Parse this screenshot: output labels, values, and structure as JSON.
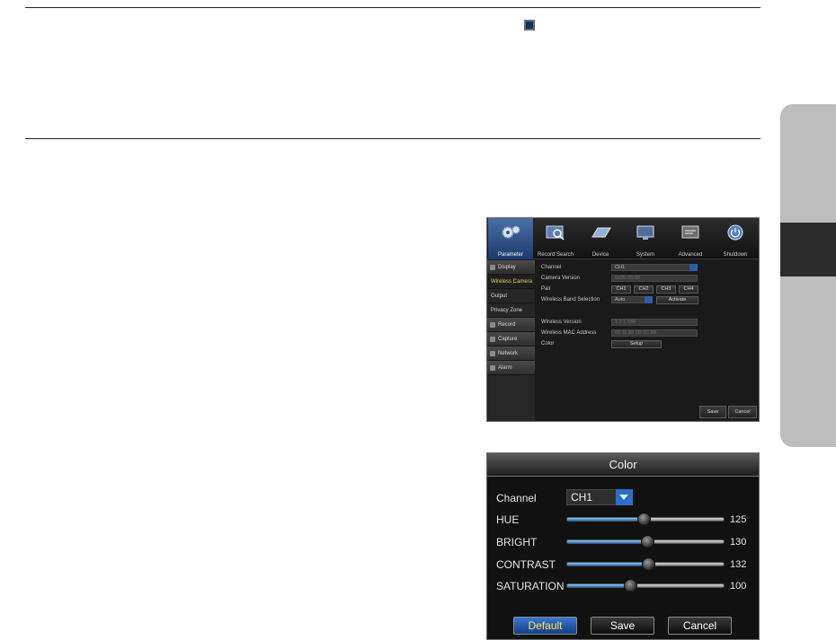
{
  "dvr": {
    "nav": [
      {
        "label": "Parameter",
        "icon": "gears-icon"
      },
      {
        "label": "Record Search",
        "icon": "search-icon"
      },
      {
        "label": "Device",
        "icon": "disk-icon"
      },
      {
        "label": "System",
        "icon": "monitor-icon"
      },
      {
        "label": "Advanced",
        "icon": "advanced-icon"
      },
      {
        "label": "Shutdown",
        "icon": "power-icon"
      }
    ],
    "sidebar": [
      {
        "label": "Display",
        "type": "header"
      },
      {
        "label": "Wireless Camera",
        "type": "selected"
      },
      {
        "label": "Output",
        "type": "item"
      },
      {
        "label": "Privacy Zone",
        "type": "item"
      },
      {
        "label": "Record",
        "type": "header"
      },
      {
        "label": "Capture",
        "type": "header"
      },
      {
        "label": "Network",
        "type": "header"
      },
      {
        "label": "Alarm",
        "type": "header"
      }
    ],
    "fields": {
      "channel_label": "Channel",
      "channel_value": "CH1",
      "camera_version_label": "Camera Version",
      "camera_version_value": "0x35-00-00",
      "pair_label": "Pair",
      "pair_buttons": [
        "CH1",
        "CH2",
        "CH3",
        "CH4"
      ],
      "band_label": "Wireless Band Selection",
      "band_value": "Auto",
      "activate_label": "Activate",
      "wireless_version_label": "Wireless Version",
      "wireless_version_value": "1.2.1.038",
      "mac_label": "Wireless MAC Address",
      "mac_value": "00:11:32:1D:1C:8B",
      "color_label": "Color",
      "setup_label": "Setup"
    },
    "save_label": "Save",
    "cancel_label": "Cancel"
  },
  "color_dialog": {
    "title": "Color",
    "channel_label": "Channel",
    "channel_value": "CH1",
    "sliders": [
      {
        "label": "HUE",
        "value": "125",
        "level": 0.49
      },
      {
        "label": "BRIGHT",
        "value": "130",
        "level": 0.51
      },
      {
        "label": "CONTRAST",
        "value": "132",
        "level": 0.52
      },
      {
        "label": "SATURATION",
        "value": "100",
        "level": 0.4
      }
    ],
    "default_label": "Default",
    "save_label": "Save",
    "cancel_label": "Cancel"
  },
  "colors": {
    "accent_blue": "#2d6fc4",
    "selected_text": "#e6d64a",
    "default_button_text": "#ffe94a"
  }
}
